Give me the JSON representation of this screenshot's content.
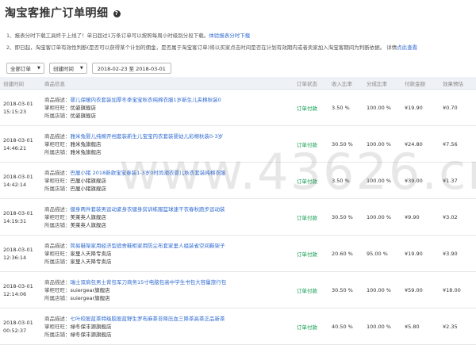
{
  "page": {
    "title": "淘宝客推广订单明细",
    "help_icon": "?",
    "watermark": "www.43626.cn"
  },
  "notes": {
    "n1_text": "1、报表分时下载工具终于上线了！单日超过1万条订单可以按照每周小时级别分段下载。",
    "n1_link": "体验报表分时下载",
    "n2_text": "2、即日起，淘宝客订单有效性判断(是否可以获得某个计划的佣金，是否属于淘宝客订单)将以买家点击时间是否在计划有效期内或者卖家加入淘宝客期间为判断依据。 详情",
    "n2_link": "点此查看"
  },
  "toolbar": {
    "filter": "全部订单",
    "sort": "创建时间",
    "date_range": "2018-02-23 至 2018-03-01"
  },
  "columns": [
    "创建时间",
    "商品信息",
    "订单状态",
    "收入比率",
    "分成比率",
    "付款金额",
    "效果预估"
  ],
  "labels": {
    "desc": "商品描述：",
    "shop_wangwang": "掌柜旺旺：",
    "shop": "所属店铺："
  },
  "rows": [
    {
      "date": "2018-03-01",
      "time": "15:15:23",
      "desc": "婴儿保暖内衣套装加厚冬季宝宝秋衣纯棉衣服1岁新生儿夹棉秋装0",
      "wangwang": "优姿旗舰店",
      "shop": "优姿旗舰店",
      "status": "订单付款",
      "income": "3.50 %",
      "share": "100.00 %",
      "amount": "¥19.90",
      "estimate": "¥0.70"
    },
    {
      "date": "2018-03-01",
      "time": "14:46:21",
      "desc": "雅米兔婴儿纯棉开裆套装新生儿宝宝内衣套装婴幼儿彩棉秋装0-3岁",
      "wangwang": "雅米兔旗舰店",
      "shop": "雅米兔旗舰店",
      "status": "订单付款",
      "income": "30.50 %",
      "share": "100.00 %",
      "amount": "¥24.80",
      "estimate": "¥7.56"
    },
    {
      "date": "2018-03-01",
      "time": "14:42:14",
      "desc": "巴厘小猪 2018新款宝宝春装1-3岁0时尚潮衣婴儿秋衣套装纯棉衣服",
      "wangwang": "巴厘小猪旗舰店",
      "shop": "巴厘小猪旗舰店",
      "status": "订单付款",
      "income": "3.50 %",
      "share": "100.00 %",
      "amount": "¥39.00",
      "estimate": "¥1.37"
    },
    {
      "date": "2018-03-01",
      "time": "14:19:31",
      "desc": "健身两件套装男运动紧身衣健身房训练服篮球速干衣春秋跑步运动装",
      "wangwang": "美莱英人旗舰店",
      "shop": "美莱英人旗舰店",
      "status": "订单付款",
      "income": "30.50 %",
      "share": "100.00 %",
      "amount": "¥9.90",
      "estimate": "¥3.02"
    },
    {
      "date": "2018-03-01",
      "time": "12:36:14",
      "desc": "简易鞋架家用经济型宿舍鞋柜家用防尘布套家里人组装省空间鞋架子",
      "wangwang": "家里人天降专卖店",
      "shop": "家里人天降专卖店",
      "status": "订单付款",
      "income": "20.60 %",
      "share": "95.00 %",
      "amount": "¥19.90",
      "estimate": "¥3.90"
    },
    {
      "date": "2018-03-01",
      "time": "12:14:06",
      "desc": "瑞士双肩包男士背包军刀商务15寸电脑包高中学生书包大容量旅行包",
      "wangwang": "suiergear旗舰店",
      "shop": "suiergear旗舰店",
      "status": "订单付款",
      "income": "30.50 %",
      "share": "100.00 %",
      "amount": "¥59.00",
      "estimate": "¥18.00"
    },
    {
      "date": "2018-03-01",
      "time": "00:52:37",
      "desc": "七叶绞股蓝茶特级胶股蓝野生罗布麻茶非降压血三降茶高茶正品新茶",
      "wangwang": "禄冬保丰源旗舰店",
      "shop": "禄冬保丰源旗舰店",
      "status": "订单付款",
      "income": "40.50 %",
      "share": "100.00 %",
      "amount": "¥5.80",
      "estimate": "¥2.35"
    }
  ]
}
